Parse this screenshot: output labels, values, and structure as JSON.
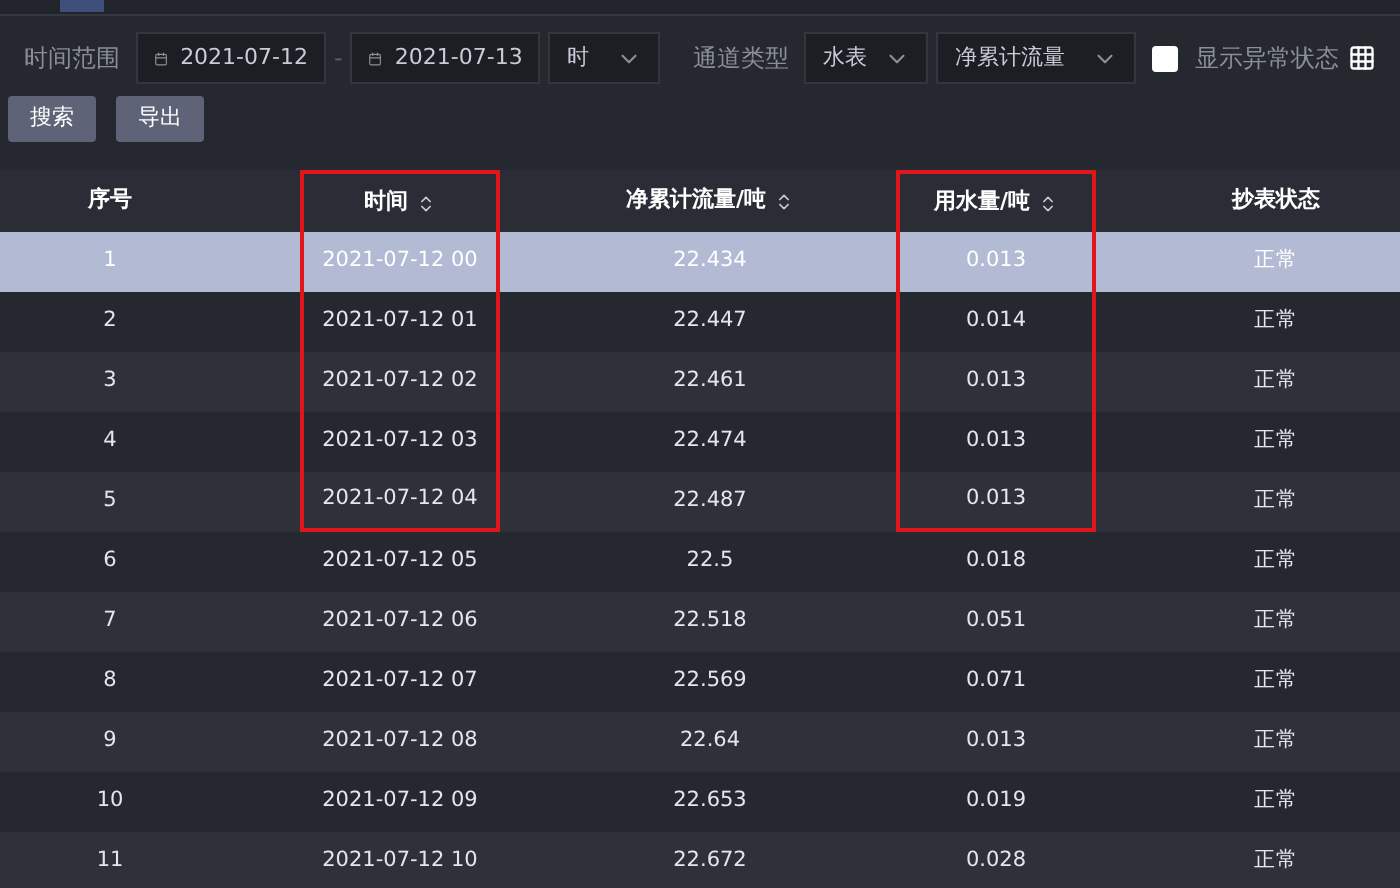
{
  "filters": {
    "time_range_label": "时间范围",
    "start_date": "2021-07-12",
    "separator": "-",
    "end_date": "2021-07-13",
    "granularity": "时",
    "channel_type_label": "通道类型",
    "channel_type": "水表",
    "metric": "净累计流量",
    "show_abnormal": {
      "label": "显示异常状态",
      "checked": false
    }
  },
  "buttons": [
    "搜索",
    "导出"
  ],
  "table": {
    "columns": [
      {
        "label": "序号",
        "sortable": false,
        "highlighted": false
      },
      {
        "label": "时间",
        "sortable": true,
        "highlighted": true
      },
      {
        "label": "净累计流量/吨",
        "sortable": true,
        "highlighted": false
      },
      {
        "label": "用水量/吨",
        "sortable": true,
        "highlighted": true
      },
      {
        "label": "抄表状态",
        "sortable": false,
        "highlighted": false
      }
    ],
    "rows": [
      {
        "cells": [
          "1",
          "2021-07-12 00",
          "22.434",
          "0.013",
          "正常"
        ],
        "selected": true,
        "marked": true
      },
      {
        "cells": [
          "2",
          "2021-07-12 01",
          "22.447",
          "0.014",
          "正常"
        ],
        "selected": false,
        "marked": true
      },
      {
        "cells": [
          "3",
          "2021-07-12 02",
          "22.461",
          "0.013",
          "正常"
        ],
        "selected": false,
        "marked": true
      },
      {
        "cells": [
          "4",
          "2021-07-12 03",
          "22.474",
          "0.013",
          "正常"
        ],
        "selected": false,
        "marked": true
      },
      {
        "cells": [
          "5",
          "2021-07-12 04",
          "22.487",
          "0.013",
          "正常"
        ],
        "selected": false,
        "marked": true
      },
      {
        "cells": [
          "6",
          "2021-07-12 05",
          "22.5",
          "0.018",
          "正常"
        ],
        "selected": false,
        "marked": false
      },
      {
        "cells": [
          "7",
          "2021-07-12 06",
          "22.518",
          "0.051",
          "正常"
        ],
        "selected": false,
        "marked": false
      },
      {
        "cells": [
          "8",
          "2021-07-12 07",
          "22.569",
          "0.071",
          "正常"
        ],
        "selected": false,
        "marked": false
      },
      {
        "cells": [
          "9",
          "2021-07-12 08",
          "22.64",
          "0.013",
          "正常"
        ],
        "selected": false,
        "marked": false
      },
      {
        "cells": [
          "10",
          "2021-07-12 09",
          "22.653",
          "0.019",
          "正常"
        ],
        "selected": false,
        "marked": false
      },
      {
        "cells": [
          "11",
          "2021-07-12 10",
          "22.672",
          "0.028",
          "正常"
        ],
        "selected": false,
        "marked": false
      }
    ]
  }
}
